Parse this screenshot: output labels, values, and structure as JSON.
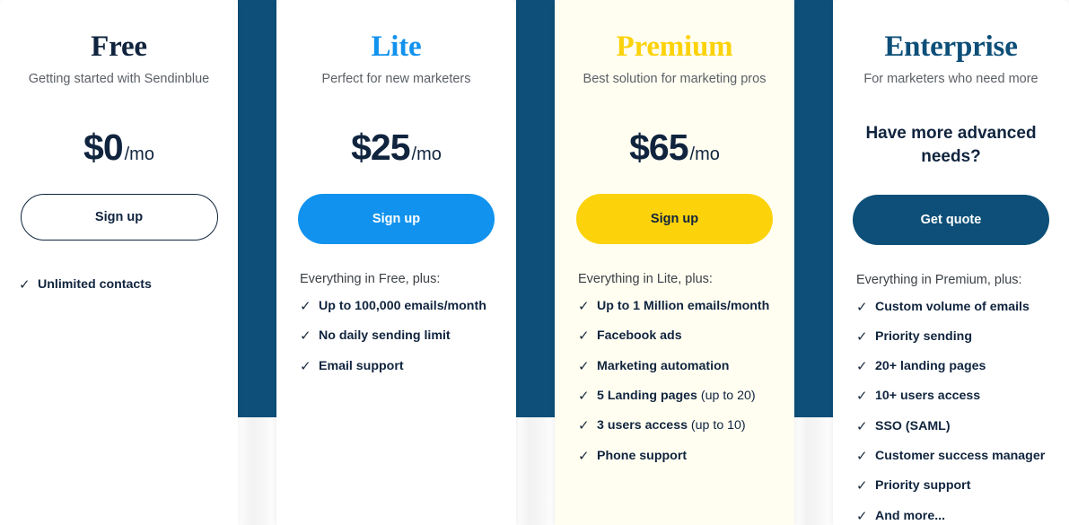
{
  "page": {
    "brand_colors": {
      "navy": "#10243e",
      "deep_blue": "#0d4f78",
      "bright_blue": "#1192ee",
      "yellow": "#fcd20a",
      "premium_card_bg": "#fffef1",
      "muted_text": "#5b6066"
    },
    "check_icon": "check-icon"
  },
  "plans": [
    {
      "id": "free",
      "name": "Free",
      "tagline": "Getting started with Sendinblue",
      "price_amount": "$0",
      "price_period": "/mo",
      "cta_label": "Sign up",
      "features_intro": "",
      "features": [
        {
          "label": "Unlimited contacts",
          "note": ""
        }
      ]
    },
    {
      "id": "lite",
      "name": "Lite",
      "tagline": "Perfect for new marketers",
      "price_amount": "$25",
      "price_period": "/mo",
      "cta_label": "Sign up",
      "features_intro": "Everything in Free, plus:",
      "features": [
        {
          "label": "Up to 100,000 emails/month",
          "note": ""
        },
        {
          "label": "No daily sending limit",
          "note": ""
        },
        {
          "label": "Email support",
          "note": ""
        }
      ]
    },
    {
      "id": "premium",
      "name": "Premium",
      "tagline": "Best solution for marketing pros",
      "price_amount": "$65",
      "price_period": "/mo",
      "cta_label": "Sign up",
      "features_intro": "Everything in Lite, plus:",
      "features": [
        {
          "label": "Up to 1 Million emails/month",
          "note": ""
        },
        {
          "label": "Facebook ads",
          "note": ""
        },
        {
          "label": "Marketing automation",
          "note": ""
        },
        {
          "label": "5 Landing pages",
          "note": " (up to 20)"
        },
        {
          "label": "3 users access",
          "note": " (up to 10)"
        },
        {
          "label": "Phone support",
          "note": ""
        }
      ]
    },
    {
      "id": "enterprise",
      "name": "Enterprise",
      "tagline": "For marketers who need more",
      "headline": "Have more advanced needs?",
      "cta_label": "Get quote",
      "features_intro": "Everything in Premium, plus:",
      "features": [
        {
          "label": "Custom volume of emails",
          "note": ""
        },
        {
          "label": "Priority sending",
          "note": ""
        },
        {
          "label": "20+ landing pages",
          "note": ""
        },
        {
          "label": "10+ users access",
          "note": ""
        },
        {
          "label": "SSO (SAML)",
          "note": ""
        },
        {
          "label": "Customer success manager",
          "note": ""
        },
        {
          "label": "Priority support",
          "note": ""
        },
        {
          "label": "And more...",
          "note": ""
        }
      ]
    }
  ]
}
